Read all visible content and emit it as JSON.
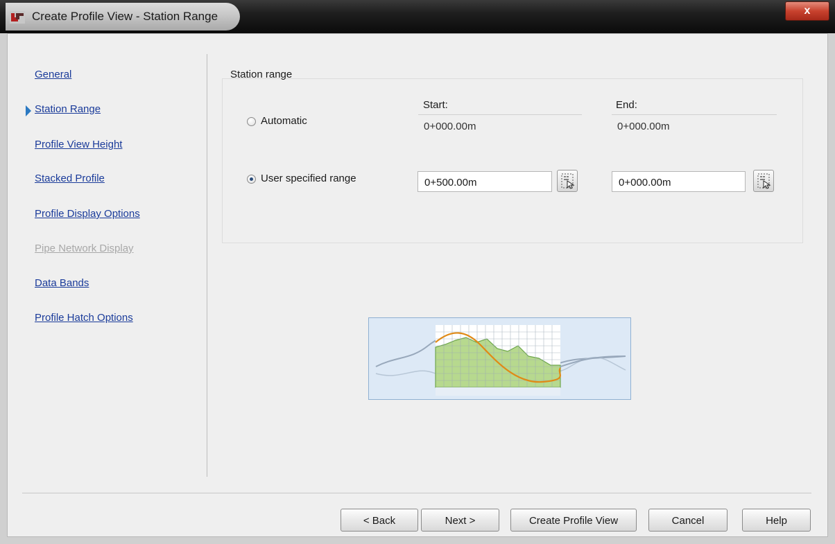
{
  "window": {
    "title": "Create Profile View - Station Range",
    "close_glyph": "x"
  },
  "nav": {
    "items": [
      {
        "label": "General",
        "enabled": true
      },
      {
        "label": "Station Range",
        "enabled": true,
        "current": true
      },
      {
        "label": "Profile View Height",
        "enabled": true
      },
      {
        "label": "Stacked Profile",
        "enabled": true
      },
      {
        "label": "Profile Display Options",
        "enabled": true
      },
      {
        "label": "Pipe Network Display",
        "enabled": false
      },
      {
        "label": "Data Bands",
        "enabled": true
      },
      {
        "label": "Profile Hatch Options",
        "enabled": true
      }
    ]
  },
  "station_range": {
    "group_label": "Station range",
    "start_header": "Start:",
    "end_header": "End:",
    "automatic": {
      "label": "Automatic",
      "selected": false,
      "start_value": "0+000.00m",
      "end_value": "0+000.00m"
    },
    "user_specified": {
      "label": "User specified range",
      "selected": true,
      "start_value": "0+500.00m",
      "end_value": "0+000.00m"
    }
  },
  "buttons": {
    "back": "< Back",
    "next": "Next >",
    "create": "Create Profile View",
    "cancel": "Cancel",
    "help": "Help"
  },
  "colors": {
    "link": "#1a3b9a",
    "disabled_link": "#a8a8a8",
    "nav_arrow": "#2b79c2",
    "profile_line": "#e08a16",
    "ground_fill": "#b6d98a"
  },
  "icons": {
    "app": "civil-3d-app-icon",
    "pick_station": "pick-station-icon",
    "current_step": "current-step-arrow-icon"
  }
}
